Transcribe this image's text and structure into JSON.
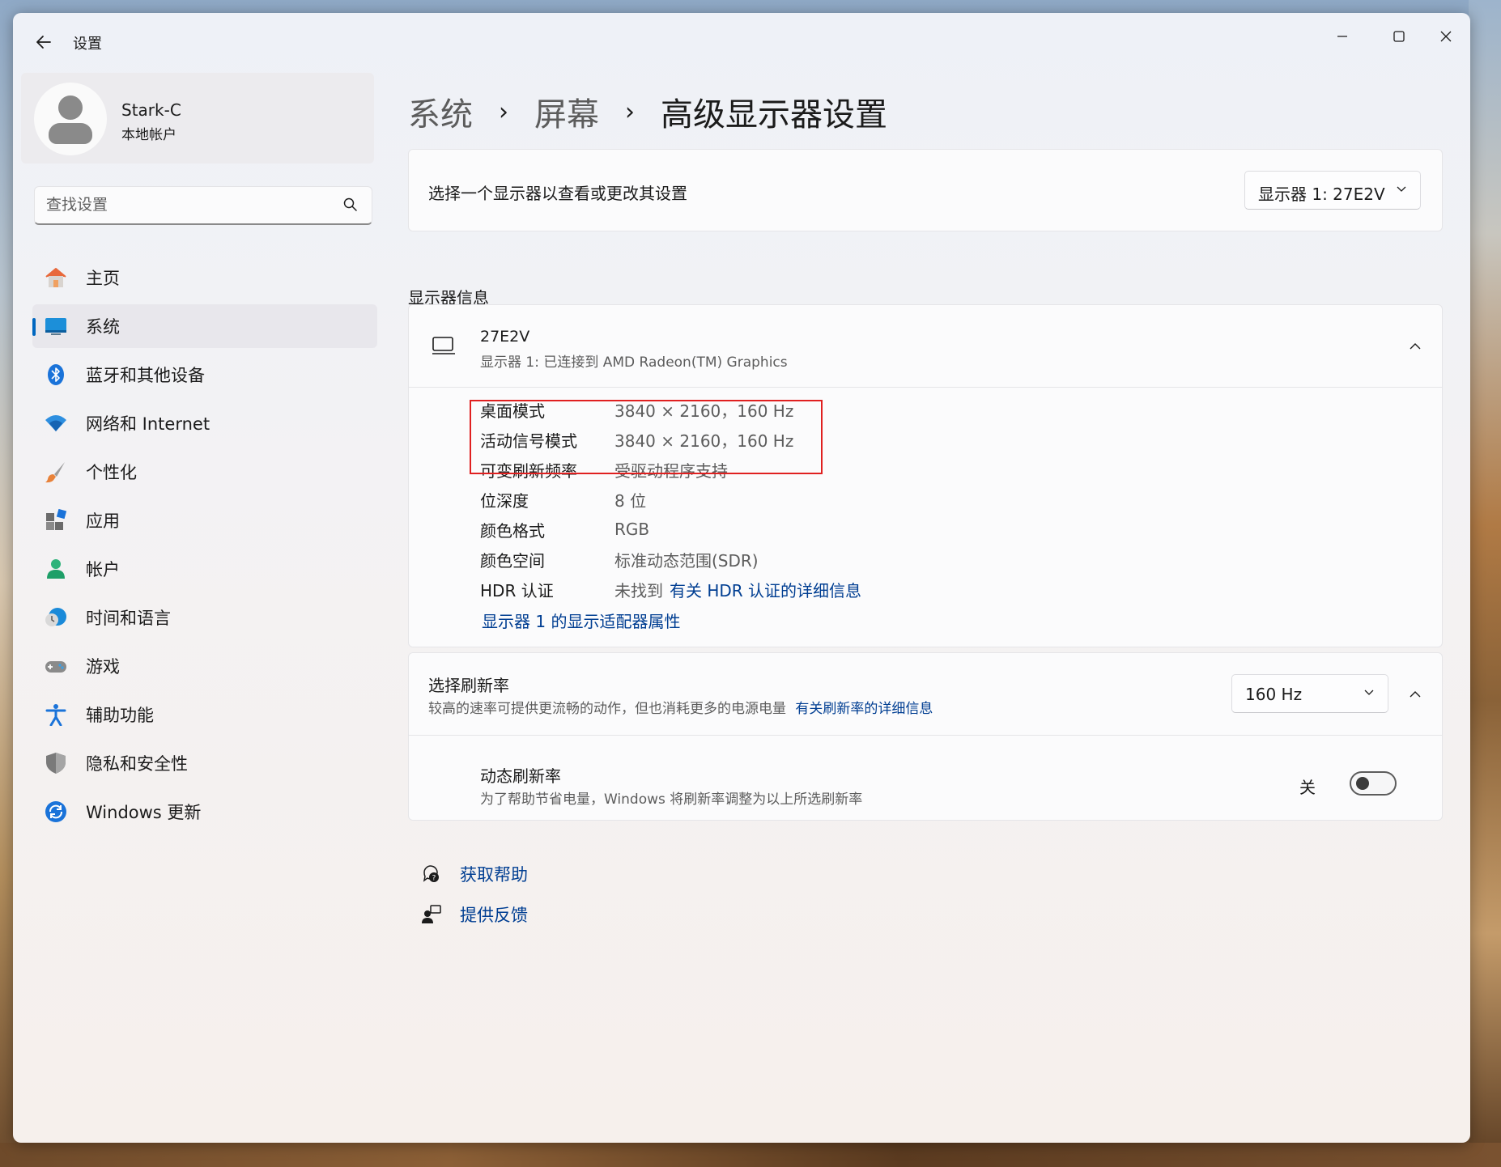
{
  "window": {
    "app_title": "设置",
    "back_label": "←",
    "minimize": "—",
    "maximize": "☐",
    "close": "✕"
  },
  "profile": {
    "name": "Stark-C",
    "account_type": "本地帐户"
  },
  "search": {
    "placeholder": "查找设置"
  },
  "sidebar": {
    "items": [
      {
        "label": "主页",
        "icon": "home-icon",
        "active": false
      },
      {
        "label": "系统",
        "icon": "system-icon",
        "active": true
      },
      {
        "label": "蓝牙和其他设备",
        "icon": "bluetooth-icon",
        "active": false
      },
      {
        "label": "网络和 Internet",
        "icon": "network-icon",
        "active": false
      },
      {
        "label": "个性化",
        "icon": "brush-icon",
        "active": false
      },
      {
        "label": "应用",
        "icon": "apps-icon",
        "active": false
      },
      {
        "label": "帐户",
        "icon": "account-icon",
        "active": false
      },
      {
        "label": "时间和语言",
        "icon": "time-language-icon",
        "active": false
      },
      {
        "label": "游戏",
        "icon": "gaming-icon",
        "active": false
      },
      {
        "label": "辅助功能",
        "icon": "accessibility-icon",
        "active": false
      },
      {
        "label": "隐私和安全性",
        "icon": "shield-icon",
        "active": false
      },
      {
        "label": "Windows 更新",
        "icon": "update-icon",
        "active": false
      }
    ]
  },
  "breadcrumb": {
    "items": [
      "系统",
      "屏幕",
      "高级显示器设置"
    ],
    "separator": "›"
  },
  "display_select": {
    "label": "选择一个显示器以查看或更改其设置",
    "selected": "显示器 1: 27E2V"
  },
  "display_info": {
    "section_title": "显示器信息",
    "monitor_name": "27E2V",
    "monitor_desc": "显示器 1: 已连接到 AMD Radeon(TM) Graphics",
    "rows": [
      {
        "key": "桌面模式",
        "value": "3840 × 2160，160 Hz"
      },
      {
        "key": "活动信号模式",
        "value": "3840 × 2160，160 Hz"
      },
      {
        "key": "可变刷新频率",
        "value": "受驱动程序支持"
      },
      {
        "key": "位深度",
        "value": "8 位"
      },
      {
        "key": "颜色格式",
        "value": "RGB"
      },
      {
        "key": "颜色空间",
        "value": "标准动态范围(SDR)"
      },
      {
        "key": "HDR 认证",
        "value": "未找到"
      }
    ],
    "hdr_link": "有关 HDR 认证的详细信息",
    "adapter_link": "显示器 1 的显示适配器属性"
  },
  "refresh_rate": {
    "title": "选择刷新率",
    "desc": "较高的速率可提供更流畅的动作，但也消耗更多的电源电量",
    "link": "有关刷新率的详细信息",
    "selected": "160 Hz",
    "dynamic_title": "动态刷新率",
    "dynamic_desc": "为了帮助节省电量，Windows 将刷新率调整为以上所选刷新率",
    "toggle_state": "关"
  },
  "help": {
    "get_help": "获取帮助",
    "feedback": "提供反馈"
  },
  "colors": {
    "accent": "#0067c0",
    "link": "#003e92",
    "highlight": "#e02020"
  }
}
